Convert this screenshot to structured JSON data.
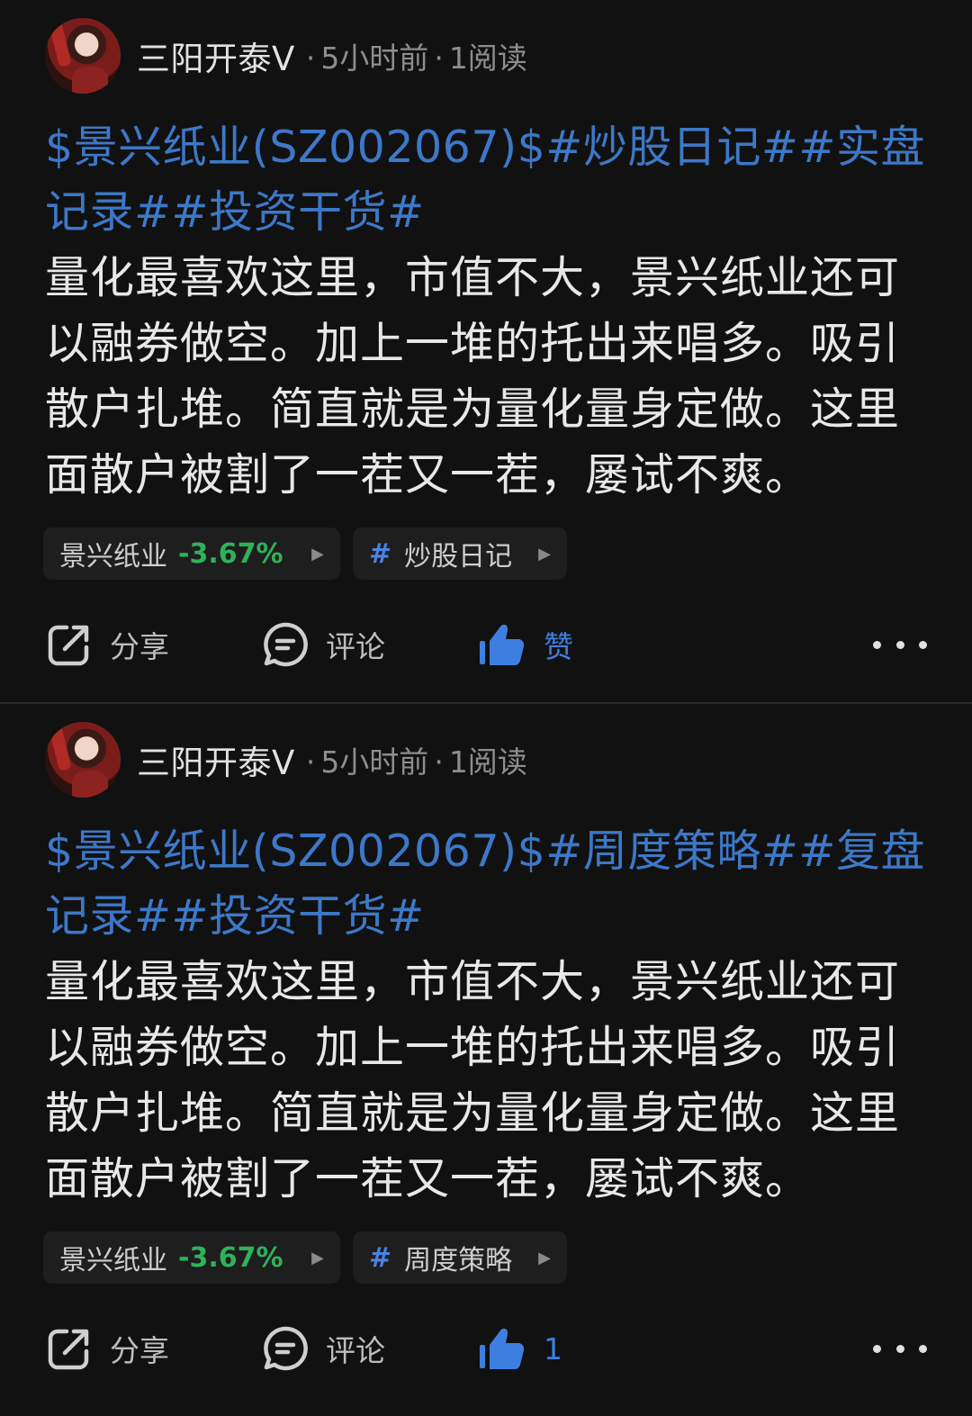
{
  "posts": [
    {
      "username": "三阳开泰V",
      "time": "5小时前",
      "reads": "1阅读",
      "title": "$景兴纸业(SZ002067)$#炒股日记##实盘记录##投资干货#",
      "body": "量化最喜欢这里，市值不大，景兴纸业还可以融券做空。加上一堆的托出来唱多。吸引散户扎堆。简直就是为量化量身定做。这里面散户被割了一茬又一茬，屡试不爽。",
      "stock_chip": {
        "name": "景兴纸业",
        "change": "-3.67%"
      },
      "topic_chip": {
        "hash": "#",
        "name": "炒股日记"
      },
      "actions": {
        "share": "分享",
        "comment": "评论",
        "like": "赞"
      }
    },
    {
      "username": "三阳开泰V",
      "time": "5小时前",
      "reads": "1阅读",
      "title": "$景兴纸业(SZ002067)$#周度策略##复盘记录##投资干货#",
      "body": "量化最喜欢这里，市值不大，景兴纸业还可以融券做空。加上一堆的托出来唱多。吸引散户扎堆。简直就是为量化量身定做。这里面散户被割了一茬又一茬，屡试不爽。",
      "stock_chip": {
        "name": "景兴纸业",
        "change": "-3.67%"
      },
      "topic_chip": {
        "hash": "#",
        "name": "周度策略"
      },
      "actions": {
        "share": "分享",
        "comment": "评论",
        "like": "1"
      }
    }
  ],
  "colors": {
    "background": "#111111",
    "link_blue": "#3d78c8",
    "like_blue": "#3d7fe0",
    "down_green": "#2fb15a"
  },
  "icons": [
    "share-icon",
    "comment-icon",
    "thumbs-up-icon",
    "more-icon",
    "chevron-right-icon",
    "hash-icon"
  ]
}
